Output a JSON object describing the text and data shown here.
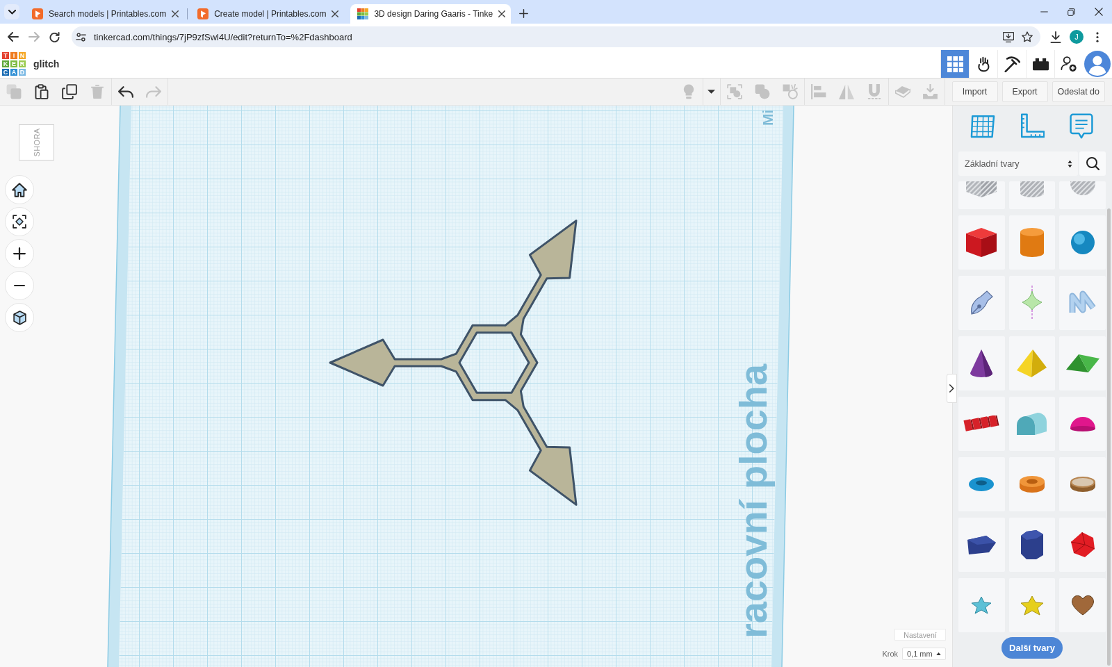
{
  "browser": {
    "tabs": [
      {
        "title": "Search models | Printables.com",
        "kind": "printables",
        "selected": false
      },
      {
        "title": "Create model | Printables.com",
        "kind": "printables",
        "selected": false
      },
      {
        "title": "3D design Daring Gaaris - Tinke",
        "kind": "tinkercad",
        "selected": true
      }
    ],
    "url": "tinkercad.com/things/7jP9zfSwl4U/edit?returnTo=%2Fdashboard",
    "profile": "J"
  },
  "app": {
    "logo": [
      {
        "letter": "T",
        "color": "#e4412f"
      },
      {
        "letter": "I",
        "color": "#ef7d22"
      },
      {
        "letter": "N",
        "color": "#f5a623"
      },
      {
        "letter": "K",
        "color": "#5fa83a"
      },
      {
        "letter": "E",
        "color": "#7dbb42"
      },
      {
        "letter": "R",
        "color": "#9acb4f"
      },
      {
        "letter": "C",
        "color": "#1b6cb3"
      },
      {
        "letter": "A",
        "color": "#2f8fd5"
      },
      {
        "letter": "D",
        "color": "#7bb9e4"
      }
    ],
    "project": "glitch",
    "nav": [
      {
        "kind": "grid",
        "selected": true
      },
      {
        "kind": "hand",
        "selected": false
      },
      {
        "kind": "pickaxe",
        "selected": false
      },
      {
        "kind": "brick",
        "selected": false
      }
    ]
  },
  "toolbar": {
    "left_groups": [
      [
        {
          "kind": "copy",
          "disabled": true
        },
        {
          "kind": "paste",
          "disabled": false
        },
        {
          "kind": "duplicate",
          "disabled": false
        },
        {
          "kind": "delete",
          "disabled": true
        }
      ],
      [
        {
          "kind": "undo",
          "disabled": false
        },
        {
          "kind": "redo",
          "disabled": true
        }
      ]
    ],
    "right_groups": [
      [
        {
          "kind": "light",
          "disabled": true
        }
      ],
      [
        {
          "kind": "menu",
          "disabled": false
        }
      ],
      [
        {
          "kind": "group",
          "disabled": true
        },
        {
          "kind": "merge",
          "disabled": true
        },
        {
          "kind": "split",
          "disabled": true
        }
      ],
      [
        {
          "kind": "align",
          "disabled": true
        },
        {
          "kind": "mirror",
          "disabled": true
        },
        {
          "kind": "magnet",
          "disabled": true
        }
      ],
      [
        {
          "kind": "tilt",
          "disabled": true
        },
        {
          "kind": "drop",
          "disabled": true
        }
      ]
    ],
    "actions": [
      "Import",
      "Export",
      "Odeslat do"
    ]
  },
  "view": {
    "cube": "SHORA"
  },
  "workplane": {
    "top_label": "Mi",
    "side_label": "racovní plocha"
  },
  "panel": {
    "category": "Základní tvary",
    "more_button": "Další tvary"
  },
  "settings": {
    "button": "Nastavení",
    "step_label": "Krok",
    "step_value": "0,1 mm"
  }
}
